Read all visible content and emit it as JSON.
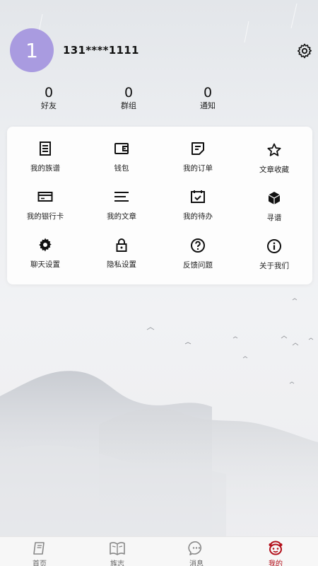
{
  "profile": {
    "avatar_text": "1",
    "phone": "131****1111"
  },
  "stats": [
    {
      "count": "0",
      "label": "好友"
    },
    {
      "count": "0",
      "label": "群组"
    },
    {
      "count": "0",
      "label": "通知"
    }
  ],
  "menu": {
    "items": [
      {
        "label": "我的族谱",
        "icon": "document-icon"
      },
      {
        "label": "钱包",
        "icon": "wallet-icon"
      },
      {
        "label": "我的订单",
        "icon": "note-icon"
      },
      {
        "label": "文章收藏",
        "icon": "star-icon"
      },
      {
        "label": "我的银行卡",
        "icon": "bank-card-icon"
      },
      {
        "label": "我的文章",
        "icon": "lines-icon"
      },
      {
        "label": "我的待办",
        "icon": "calendar-check-icon"
      },
      {
        "label": "寻谱",
        "icon": "cube-icon"
      },
      {
        "label": "聊天设置",
        "icon": "gear-icon"
      },
      {
        "label": "隐私设置",
        "icon": "lock-icon"
      },
      {
        "label": "反馈问题",
        "icon": "question-icon"
      },
      {
        "label": "关于我们",
        "icon": "info-icon"
      }
    ]
  },
  "tabbar": {
    "tabs": [
      {
        "label": "首页",
        "icon": "book-icon"
      },
      {
        "label": "族志",
        "icon": "open-book-icon"
      },
      {
        "label": "消息",
        "icon": "chat-bubble-icon"
      },
      {
        "label": "我的",
        "icon": "profile-face-icon",
        "active": true
      }
    ],
    "active_color": "#b30f1a"
  },
  "colors": {
    "avatar": "#a99be0",
    "accent": "#b30f1a"
  }
}
